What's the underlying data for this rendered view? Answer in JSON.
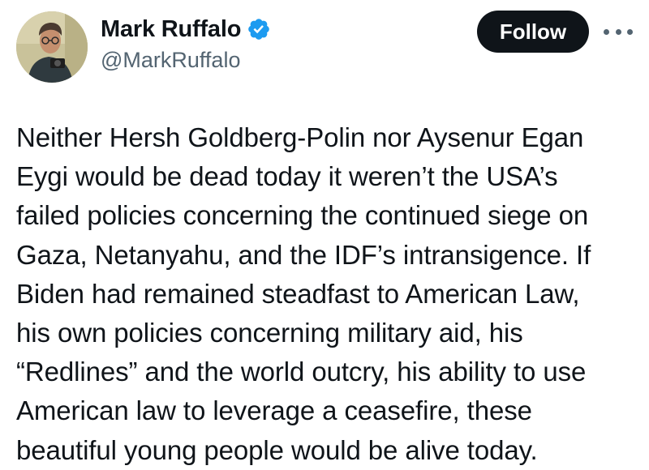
{
  "author": {
    "display_name": "Mark Ruffalo",
    "handle": "@MarkRuffalo",
    "verified_icon": "verified-badge-icon",
    "avatar_icon": "profile-photo"
  },
  "actions": {
    "follow_label": "Follow",
    "more_icon": "more-options-icon"
  },
  "tweet": {
    "text": "Neither Hersh Goldberg-Polin nor Aysenur Egan\nEygi would be dead today it weren’t the USA’s\nfailed policies concerning the continued siege on\nGaza, Netanyahu, and the IDF’s intransigence. If\nBiden had remained steadfast to American Law,\nhis own policies concerning military aid, his\n“Redlines” and the world outcry, his ability to use\nAmerican law to leverage a ceasefire, these\nbeautiful young people would be alive today."
  },
  "colors": {
    "text_primary": "#0f1419",
    "text_secondary": "#536471",
    "verified_blue": "#1d9bf0",
    "follow_bg": "#0f1419",
    "follow_text": "#ffffff"
  }
}
